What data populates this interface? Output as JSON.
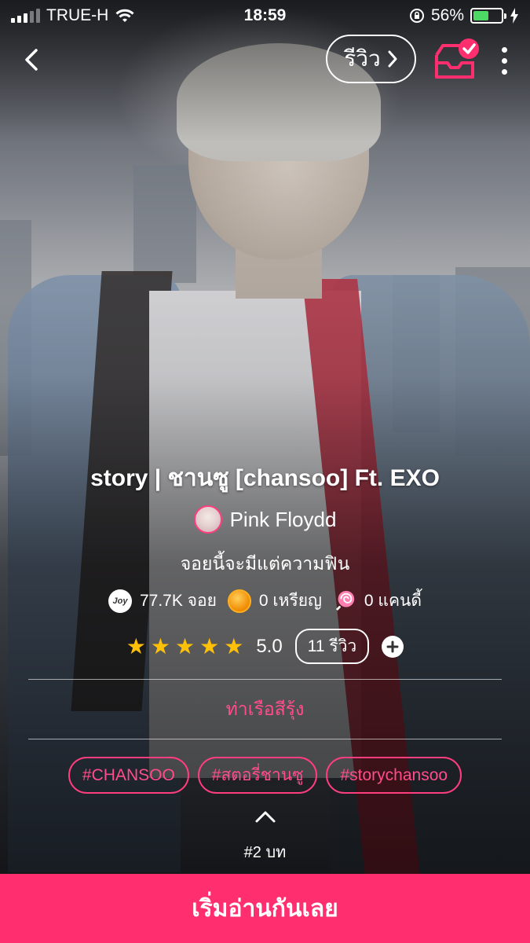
{
  "status_bar": {
    "carrier": "TRUE-H",
    "time": "18:59",
    "battery_percent": "56%",
    "battery_level": 0.56,
    "battery_color": "#4cd964"
  },
  "nav": {
    "back_icon": "chevron-left-icon",
    "review_label": "รีวิว",
    "review_icon": "chevron-right-icon",
    "inbox_icon": "inbox-check-icon",
    "more_icon": "more-vertical-icon"
  },
  "story": {
    "title": "story | ชานซู  [chansoo] Ft. EXO",
    "author": "Pink Floydd",
    "tagline": "จอยนี้จะมีแต่ความฟิน",
    "stats": {
      "joy_icon_text": "Joy",
      "joy": "77.7K จอย",
      "coins": "0 เหรียญ",
      "candy": "0 แคนดี้"
    },
    "rating_stars": 5,
    "rating": "5.0",
    "review_count": "11 รีวิว",
    "category": "ท่าเรือสีรุ้ง",
    "tags": [
      "#CHANSOO",
      "#สตอรี่ชานซู",
      "#storychansoo"
    ],
    "chapter": "#2 บท"
  },
  "cta": {
    "label": "เริ่มอ่านกันเลย"
  },
  "colors": {
    "accent": "#ff2e6e",
    "tag_pink": "#ff4d8b",
    "star": "#ffc107"
  }
}
